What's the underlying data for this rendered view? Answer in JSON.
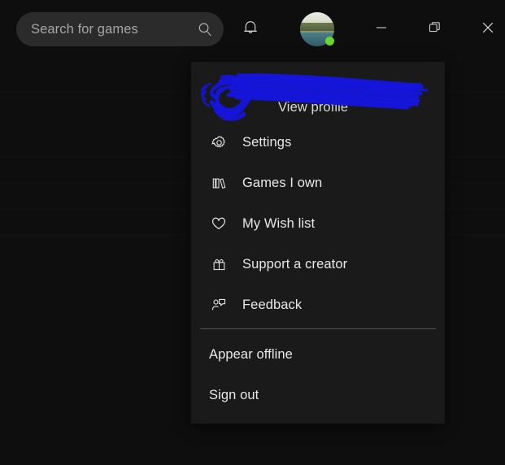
{
  "window": {
    "background_color": "#0e0e0e",
    "controls": [
      {
        "name": "minimize",
        "glyph": "minimize-icon",
        "label": "Minimize"
      },
      {
        "name": "restore",
        "glyph": "restore-icon",
        "label": "Restore"
      },
      {
        "name": "close",
        "glyph": "close-icon",
        "label": "Close"
      }
    ]
  },
  "titlebar": {
    "search": {
      "placeholder": "Search for games",
      "value": "",
      "icon": "search-icon"
    },
    "notifications": {
      "icon": "bell-icon",
      "label": "Notifications"
    },
    "avatar": {
      "icon": "avatar",
      "label": "Account",
      "status": "online",
      "status_color": "#6bd62a"
    }
  },
  "account_menu": {
    "panel_color": "#1a1a1a",
    "redaction": {
      "color": "#1515dd",
      "note": "hand-drawn scribble over profile name and picture"
    },
    "profile": {
      "label": "View profile",
      "icon": "avatar"
    },
    "items": [
      {
        "label": "Settings",
        "icon": "gear-icon"
      },
      {
        "label": "Games I own",
        "icon": "library-icon"
      },
      {
        "label": "My Wish list",
        "icon": "heart-icon"
      },
      {
        "label": "Support a creator",
        "icon": "gift-icon"
      },
      {
        "label": "Feedback",
        "icon": "feedback-person-icon"
      }
    ],
    "footer_items": [
      {
        "label": "Appear offline"
      },
      {
        "label": "Sign out"
      }
    ]
  }
}
